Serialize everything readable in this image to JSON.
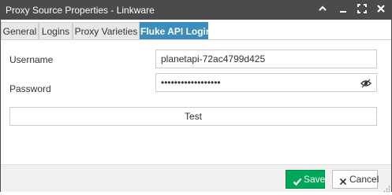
{
  "window": {
    "title": "Proxy Source Properties - Linkware"
  },
  "tabs": [
    {
      "label": "General",
      "active": false
    },
    {
      "label": "Logins",
      "active": false
    },
    {
      "label": "Proxy Varieties",
      "active": false
    },
    {
      "label": "Fluke API Login",
      "active": true
    }
  ],
  "form": {
    "username_label": "Username",
    "username_value": "planetapi-72ac4799d425",
    "password_label": "Password",
    "password_value": "••••••••••••••••••",
    "test_label": "Test"
  },
  "footer": {
    "save_label": "Save",
    "cancel_label": "Cancel"
  },
  "icons": {
    "collapse": "chevron-up-icon",
    "minimize": "minimize-icon",
    "maximize": "expand-icon",
    "close": "close-icon",
    "reveal": "eye-icon",
    "save": "check-icon",
    "cancel": "x-icon"
  },
  "colors": {
    "titlebar": "#4b4b4b",
    "active_tab": "#3c8dbc",
    "save_button": "#00a65a"
  }
}
